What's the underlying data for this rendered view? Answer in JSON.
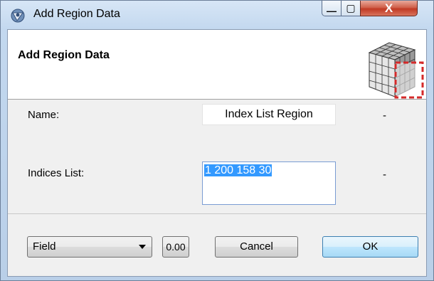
{
  "window": {
    "title": "Add Region Data",
    "buttons": {
      "minimize": "—",
      "maximize": "▢",
      "close": "X"
    },
    "accent_close": "#c13a24"
  },
  "header": {
    "title": "Add Region Data",
    "icon": "cube-region-icon"
  },
  "form": {
    "name_label": "Name:",
    "name_value": "Index List Region",
    "name_status": "-",
    "indices_label": "Indices List:",
    "indices_value": "1 200 158 30",
    "indices_status": "-"
  },
  "footer": {
    "field_select": "Field",
    "value_button": "0.00",
    "cancel_label": "Cancel",
    "ok_label": "OK"
  }
}
